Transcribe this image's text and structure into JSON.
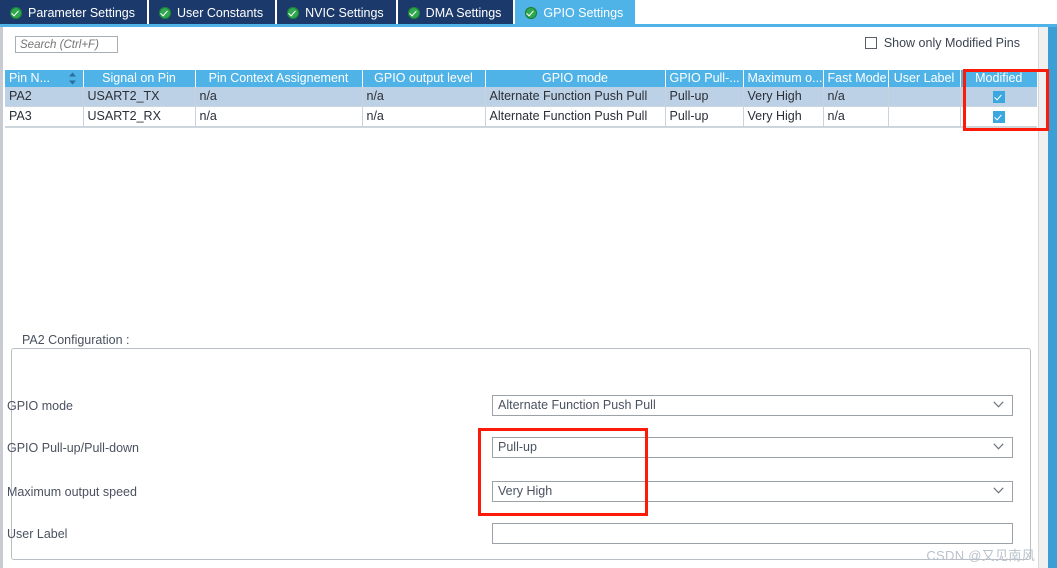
{
  "tabs": [
    {
      "label": "Parameter Settings",
      "icon": "check-circle-icon",
      "active": false
    },
    {
      "label": "User Constants",
      "icon": "check-circle-icon",
      "active": false
    },
    {
      "label": "NVIC Settings",
      "icon": "check-circle-icon",
      "active": false
    },
    {
      "label": "DMA Settings",
      "icon": "check-circle-icon",
      "active": false
    },
    {
      "label": "GPIO Settings",
      "icon": "check-circle-icon",
      "active": true
    }
  ],
  "toolbar": {
    "search_placeholder": "Search (Ctrl+F)",
    "search_value": "",
    "show_only_modified_label": "Show only Modified Pins",
    "show_only_modified_checked": false
  },
  "grid": {
    "columns": [
      "Pin N...",
      "Signal on Pin",
      "Pin Context Assignement",
      "GPIO output level",
      "GPIO mode",
      "GPIO Pull-...",
      "Maximum o...",
      "Fast Mode",
      "User Label",
      "Modified"
    ],
    "sort_column": "Pin N...",
    "rows": [
      {
        "pin": "PA2",
        "signal": "USART2_TX",
        "context": "n/a",
        "output_level": "n/a",
        "mode": "Alternate Function Push Pull",
        "pull": "Pull-up",
        "max_speed": "Very High",
        "fast_mode": "n/a",
        "user_label": "",
        "modified": true,
        "selected": true
      },
      {
        "pin": "PA3",
        "signal": "USART2_RX",
        "context": "n/a",
        "output_level": "n/a",
        "mode": "Alternate Function Push Pull",
        "pull": "Pull-up",
        "max_speed": "Very High",
        "fast_mode": "n/a",
        "user_label": "",
        "modified": true,
        "selected": false
      }
    ]
  },
  "config": {
    "group_title": "PA2 Configuration :",
    "fields": {
      "gpio_mode_label": "GPIO mode",
      "gpio_mode_value": "Alternate Function Push Pull",
      "pull_label": "GPIO Pull-up/Pull-down",
      "pull_value": "Pull-up",
      "speed_label": "Maximum output speed",
      "speed_value": "Very High",
      "user_label_label": "User Label",
      "user_label_value": ""
    }
  },
  "annotations": {
    "highlight_color": "#fb1b08",
    "boxes": [
      "modified-column",
      "pull-and-speed-fields"
    ]
  },
  "watermark": "CSDN @又见南风",
  "colors": {
    "tab_inactive_bg": "#1b3a6b",
    "tab_active_bg": "#4fb3e8",
    "header_bg": "#4fb3e8",
    "row_selected_bg": "#bdd1e6",
    "check_blue": "#3ba7e0",
    "icon_green": "#2fa84f"
  }
}
